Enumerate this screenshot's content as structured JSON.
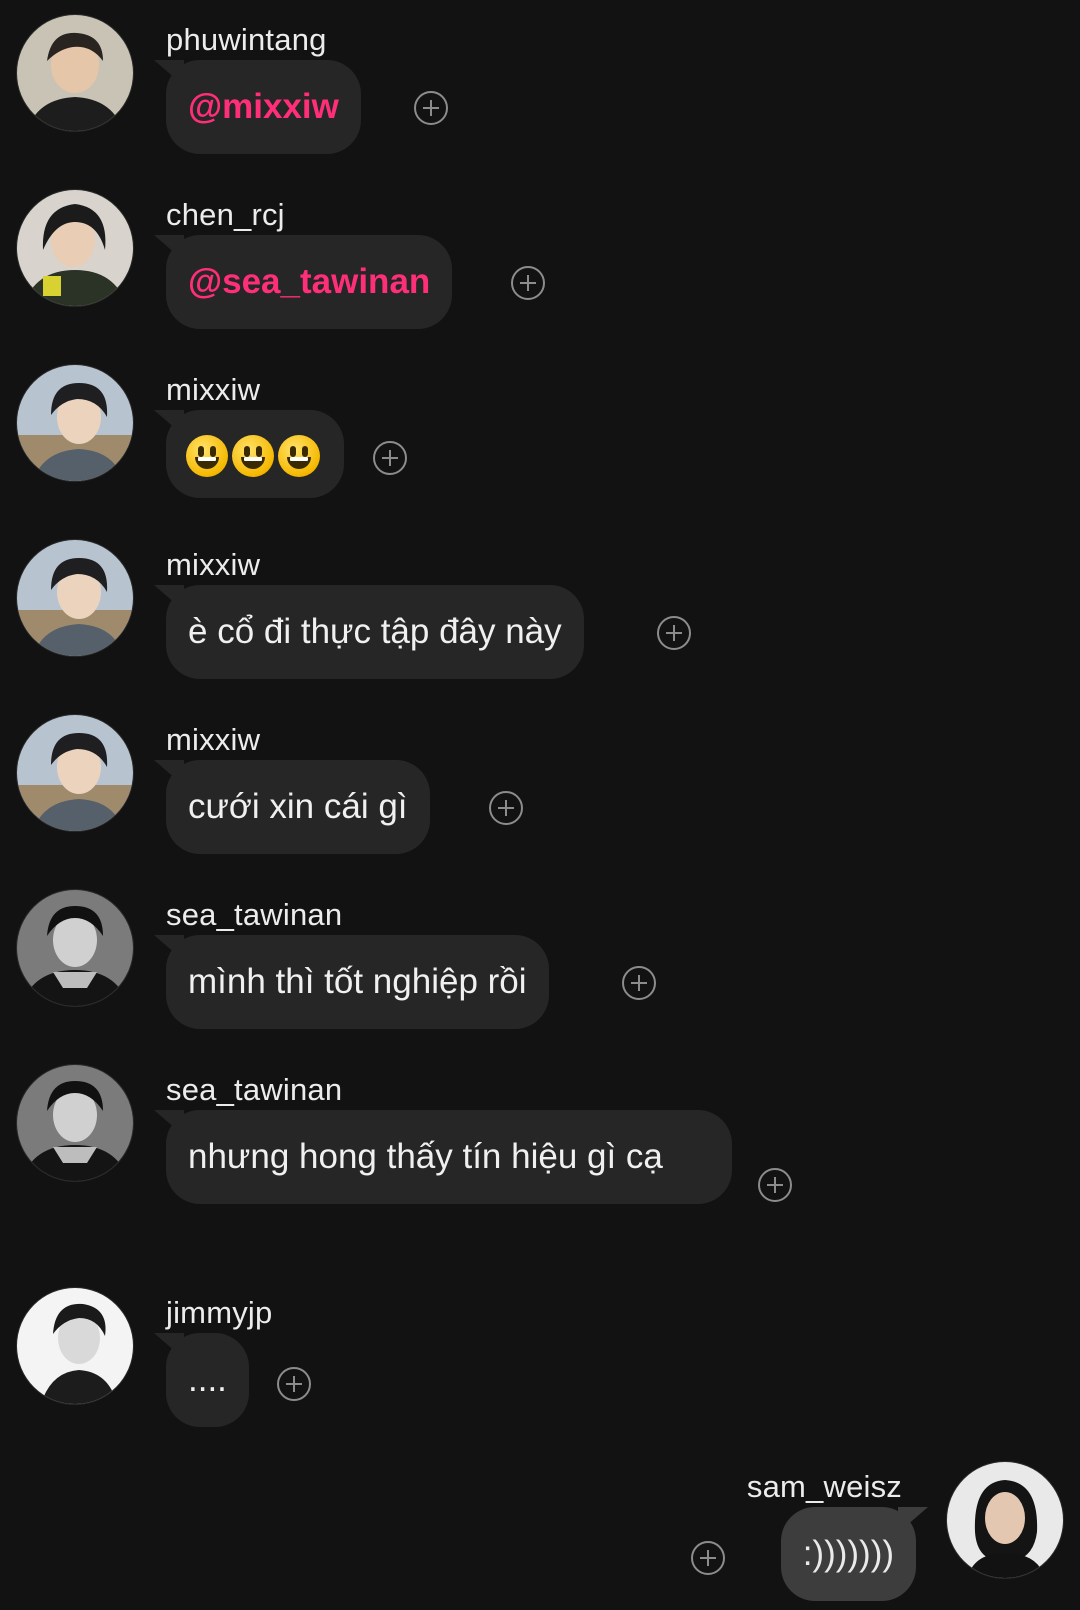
{
  "messages": [
    {
      "user": "phuwintang",
      "text": "@mixxiw",
      "kind": "mention"
    },
    {
      "user": "chen_rcj",
      "text": "@sea_tawinan",
      "kind": "mention"
    },
    {
      "user": "mixxiw",
      "text": "😃😃😃",
      "kind": "emoji"
    },
    {
      "user": "mixxiw",
      "text": "è cổ đi thực tập đây này",
      "kind": "text"
    },
    {
      "user": "mixxiw",
      "text": "cưới xin cái gì",
      "kind": "text"
    },
    {
      "user": "sea_tawinan",
      "text": "mình thì tốt nghiệp rồi",
      "kind": "text"
    },
    {
      "user": "sea_tawinan",
      "text": "nhưng hong thấy tín hiệu gì cạ",
      "kind": "text"
    },
    {
      "user": "jimmyjp",
      "text": "....",
      "kind": "text"
    }
  ],
  "self_message": {
    "user": "sam_weisz",
    "text": ":)))))))"
  },
  "icons": {
    "react": "add-reaction-icon"
  },
  "colors": {
    "background": "#121212",
    "bubble": "#262626",
    "self_bubble": "#3d3d3d",
    "mention": "#ff2e79"
  }
}
